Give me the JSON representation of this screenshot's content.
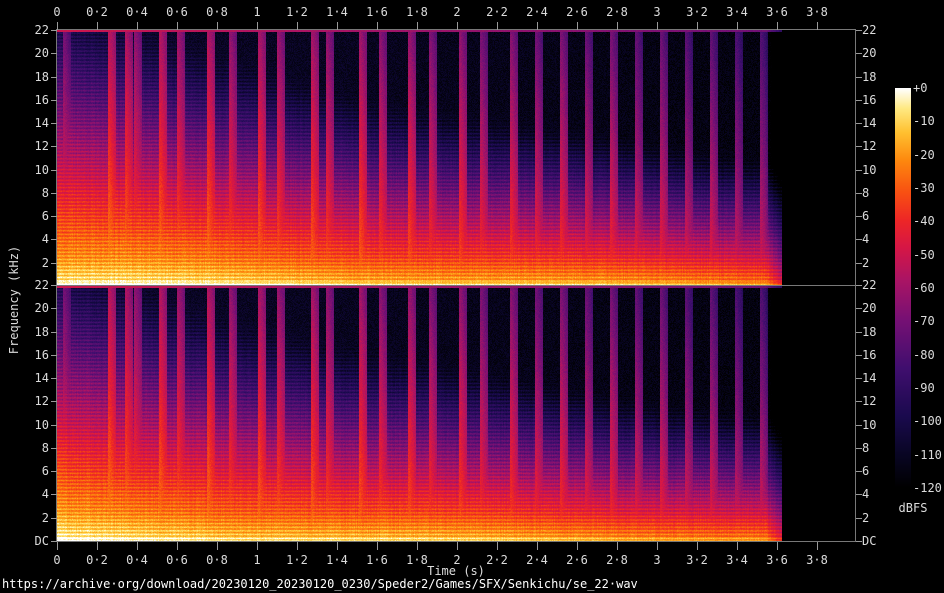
{
  "app": {
    "description": "Dual-channel audio spectrogram with colorbar"
  },
  "axes": {
    "time_title": "Time (s)",
    "freq_title": "Frequency (kHz)",
    "time_ticks": [
      "0",
      "0·2",
      "0·4",
      "0·6",
      "0·8",
      "1",
      "1·2",
      "1·4",
      "1·6",
      "1·8",
      "2",
      "2·2",
      "2·4",
      "2·6",
      "2·8",
      "3",
      "3·2",
      "3·4",
      "3·6",
      "3·8"
    ],
    "freq_ticks_top_panel": [
      "22",
      "20",
      "18",
      "16",
      "14",
      "12",
      "10",
      "8",
      "6",
      "4",
      "2"
    ],
    "freq_ticks_bottom_panel": [
      "22",
      "20",
      "18",
      "16",
      "14",
      "12",
      "10",
      "8",
      "6",
      "4",
      "2",
      "DC"
    ]
  },
  "colorbar": {
    "title": "dBFS",
    "ticks": [
      "+0",
      "-10",
      "-20",
      "-30",
      "-40",
      "-50",
      "-60",
      "-70",
      "-80",
      "-90",
      "-100",
      "-110",
      "-120"
    ]
  },
  "footer": {
    "url": "https://archive·org/download/20230120_20230120_0230/Speder2/Games/SFX/Senkichu/se_22·wav"
  },
  "colors": {
    "background": "#000000",
    "panel_border": "#787878",
    "tick": "#9a9a9a",
    "label_text": "#dcdcdc",
    "url_text": "#ffffff"
  },
  "chart_data": {
    "type": "heatmap",
    "subtype": "audio-spectrogram",
    "channels": 2,
    "title": "",
    "xlabel": "Time (s)",
    "ylabel": "Frequency (kHz)",
    "x_range_s": [
      0,
      3.99
    ],
    "y_range_khz": [
      0,
      22
    ],
    "x_tick_values_s": [
      0,
      0.2,
      0.4,
      0.6,
      0.8,
      1,
      1.2,
      1.4,
      1.6,
      1.8,
      2,
      2.2,
      2.4,
      2.6,
      2.8,
      3,
      3.2,
      3.4,
      3.6,
      3.8
    ],
    "y_tick_values_khz": [
      22,
      20,
      18,
      16,
      14,
      12,
      10,
      8,
      6,
      4,
      2,
      0
    ],
    "grid": false,
    "legend_position": "right-colorbar",
    "colorbar": {
      "label": "dBFS",
      "range_db": [
        -120,
        0
      ],
      "tick_values_db": [
        0,
        -10,
        -20,
        -30,
        -40,
        -50,
        -60,
        -70,
        -80,
        -90,
        -100,
        -110,
        -120
      ],
      "gradient_stops": [
        {
          "u": 0.0,
          "rgb": [
            0,
            0,
            0
          ]
        },
        {
          "u": 0.08,
          "rgb": [
            8,
            5,
            34
          ]
        },
        {
          "u": 0.18,
          "rgb": [
            26,
            10,
            78
          ]
        },
        {
          "u": 0.3,
          "rgb": [
            64,
            14,
            110
          ]
        },
        {
          "u": 0.42,
          "rgb": [
            118,
            16,
            116
          ]
        },
        {
          "u": 0.52,
          "rgb": [
            170,
            20,
            100
          ]
        },
        {
          "u": 0.6,
          "rgb": [
            213,
            22,
            70
          ]
        },
        {
          "u": 0.67,
          "rgb": [
            237,
            38,
            38
          ]
        },
        {
          "u": 0.74,
          "rgb": [
            248,
            80,
            18
          ]
        },
        {
          "u": 0.82,
          "rgb": [
            253,
            136,
            14
          ]
        },
        {
          "u": 0.89,
          "rgb": [
            255,
            192,
            48
          ]
        },
        {
          "u": 0.95,
          "rgb": [
            255,
            233,
            130
          ]
        },
        {
          "u": 1.0,
          "rgb": [
            255,
            255,
            255
          ]
        }
      ]
    },
    "signal_end_s": 3.62,
    "features": {
      "description": "Percussive jingle: strong harmonic low band below ~2.5 kHz (yellow/orange) lasting to ~3.6 s, regularly spaced broadband transient strokes decaying over time, harmonic stripes up the spectrum, dark-blue noise floor near -110 dBFS, bright aliasing line at 22 kHz, silence (black) after ~3.6 s.",
      "low_band_peak_db": -10,
      "spectral_tilt_db_per_khz": -4.0,
      "tilt_increase_db_per_khz_per_s": 1.2,
      "decay_db_per_s": -5,
      "harmonic_spacing_khz": 0.31,
      "noise_floor_db": -113,
      "transients": [
        {
          "t": 0.035,
          "db": -40
        },
        {
          "t": 0.26,
          "db": -24
        },
        {
          "t": 0.345,
          "db": -27
        },
        {
          "t": 0.39,
          "db": -34
        },
        {
          "t": 0.515,
          "db": -26
        },
        {
          "t": 0.605,
          "db": -31
        },
        {
          "t": 0.755,
          "db": -26
        },
        {
          "t": 0.865,
          "db": -33
        },
        {
          "t": 1.01,
          "db": -28
        },
        {
          "t": 1.105,
          "db": -32
        },
        {
          "t": 1.275,
          "db": -29
        },
        {
          "t": 1.35,
          "db": -34
        },
        {
          "t": 1.515,
          "db": -30
        },
        {
          "t": 1.615,
          "db": -35
        },
        {
          "t": 1.76,
          "db": -32
        },
        {
          "t": 1.865,
          "db": -37
        },
        {
          "t": 2.015,
          "db": -34
        },
        {
          "t": 2.12,
          "db": -39
        },
        {
          "t": 2.27,
          "db": -36
        },
        {
          "t": 2.395,
          "db": -41
        },
        {
          "t": 2.52,
          "db": -38
        },
        {
          "t": 2.645,
          "db": -43
        },
        {
          "t": 2.77,
          "db": -40
        },
        {
          "t": 2.895,
          "db": -45
        },
        {
          "t": 3.02,
          "db": -43
        },
        {
          "t": 3.145,
          "db": -48
        },
        {
          "t": 3.27,
          "db": -46
        },
        {
          "t": 3.395,
          "db": -51
        },
        {
          "t": 3.52,
          "db": -50
        }
      ]
    }
  }
}
